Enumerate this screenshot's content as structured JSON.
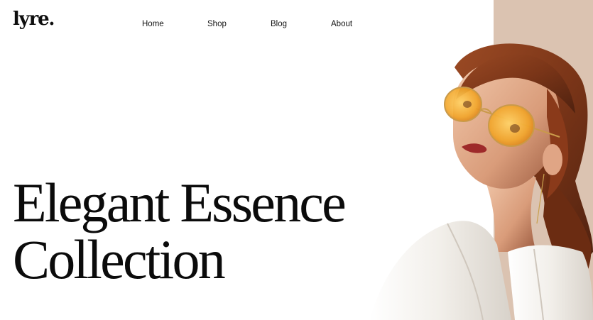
{
  "brand": {
    "logo_text": "lyre."
  },
  "nav": {
    "items": [
      {
        "label": "Home"
      },
      {
        "label": "Shop"
      },
      {
        "label": "Blog"
      },
      {
        "label": "About"
      }
    ]
  },
  "hero": {
    "title_line1": "Elegant Essence",
    "title_line2": "Collection"
  },
  "colors": {
    "panel": "#dbc3b1",
    "text": "#111111"
  },
  "image": {
    "subject": "hero-model-photo"
  }
}
